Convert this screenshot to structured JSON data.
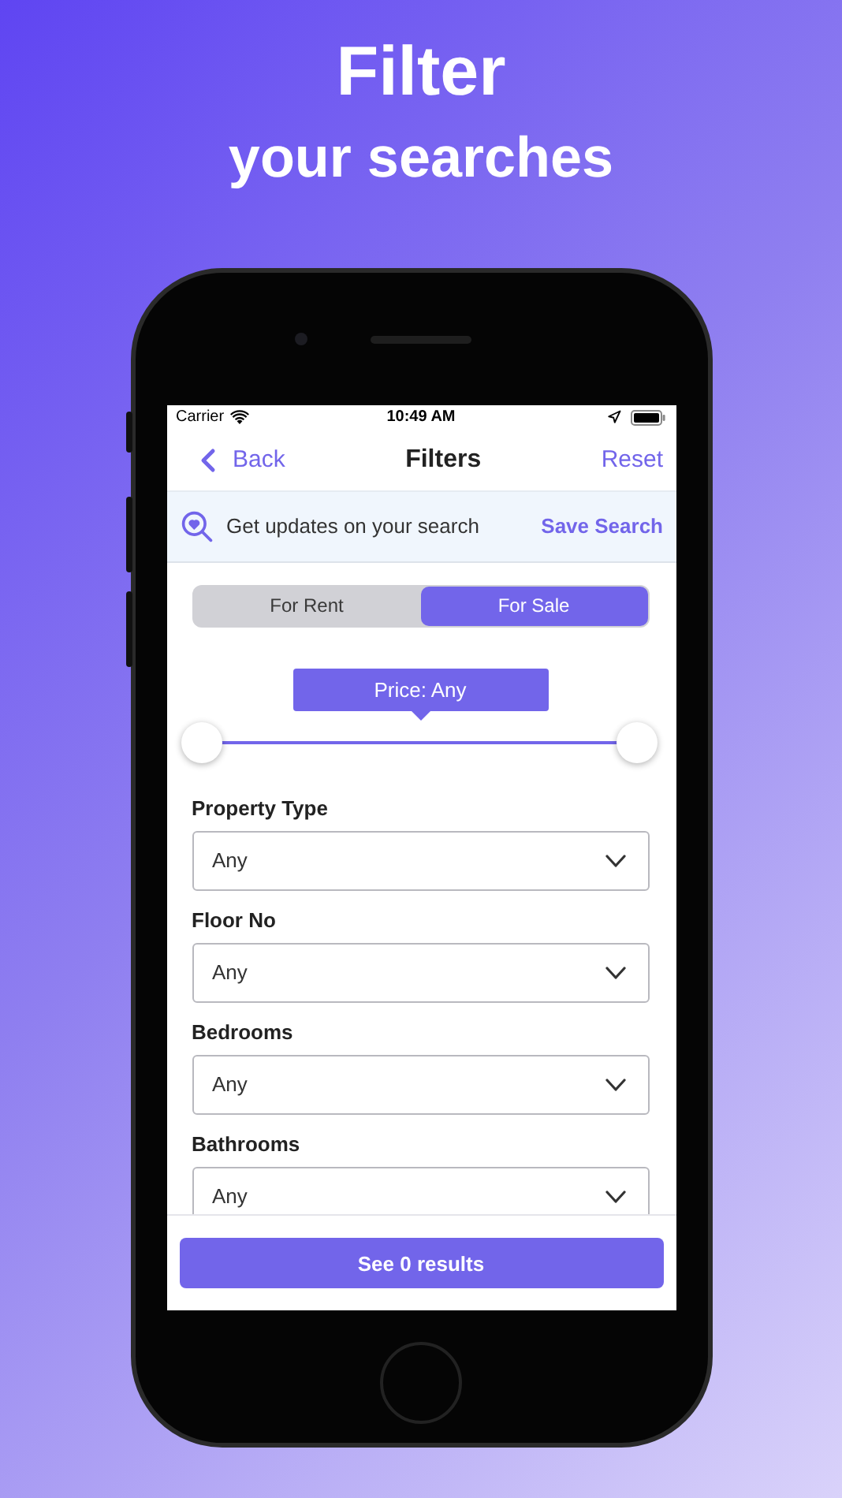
{
  "headline": {
    "title": "Filter",
    "subtitle": "your searches"
  },
  "status_bar": {
    "carrier": "Carrier",
    "time": "10:49 AM"
  },
  "nav": {
    "back": "Back",
    "title": "Filters",
    "action": "Reset"
  },
  "banner": {
    "text": "Get updates on your search",
    "action": "Save Search"
  },
  "tabs": [
    {
      "label": "For Rent",
      "selected": false
    },
    {
      "label": "For Sale",
      "selected": true
    }
  ],
  "price": {
    "label": "Price: Any",
    "thumbs": [
      {
        "level": 0
      },
      {
        "level": 1
      }
    ]
  },
  "fields": [
    {
      "label": "Property Type",
      "value": "Any"
    },
    {
      "label": "Floor No",
      "value": "Any"
    },
    {
      "label": "Bedrooms",
      "value": "Any"
    },
    {
      "label": "Bathrooms",
      "value": "Any"
    }
  ],
  "footer_button": "See 0 results"
}
